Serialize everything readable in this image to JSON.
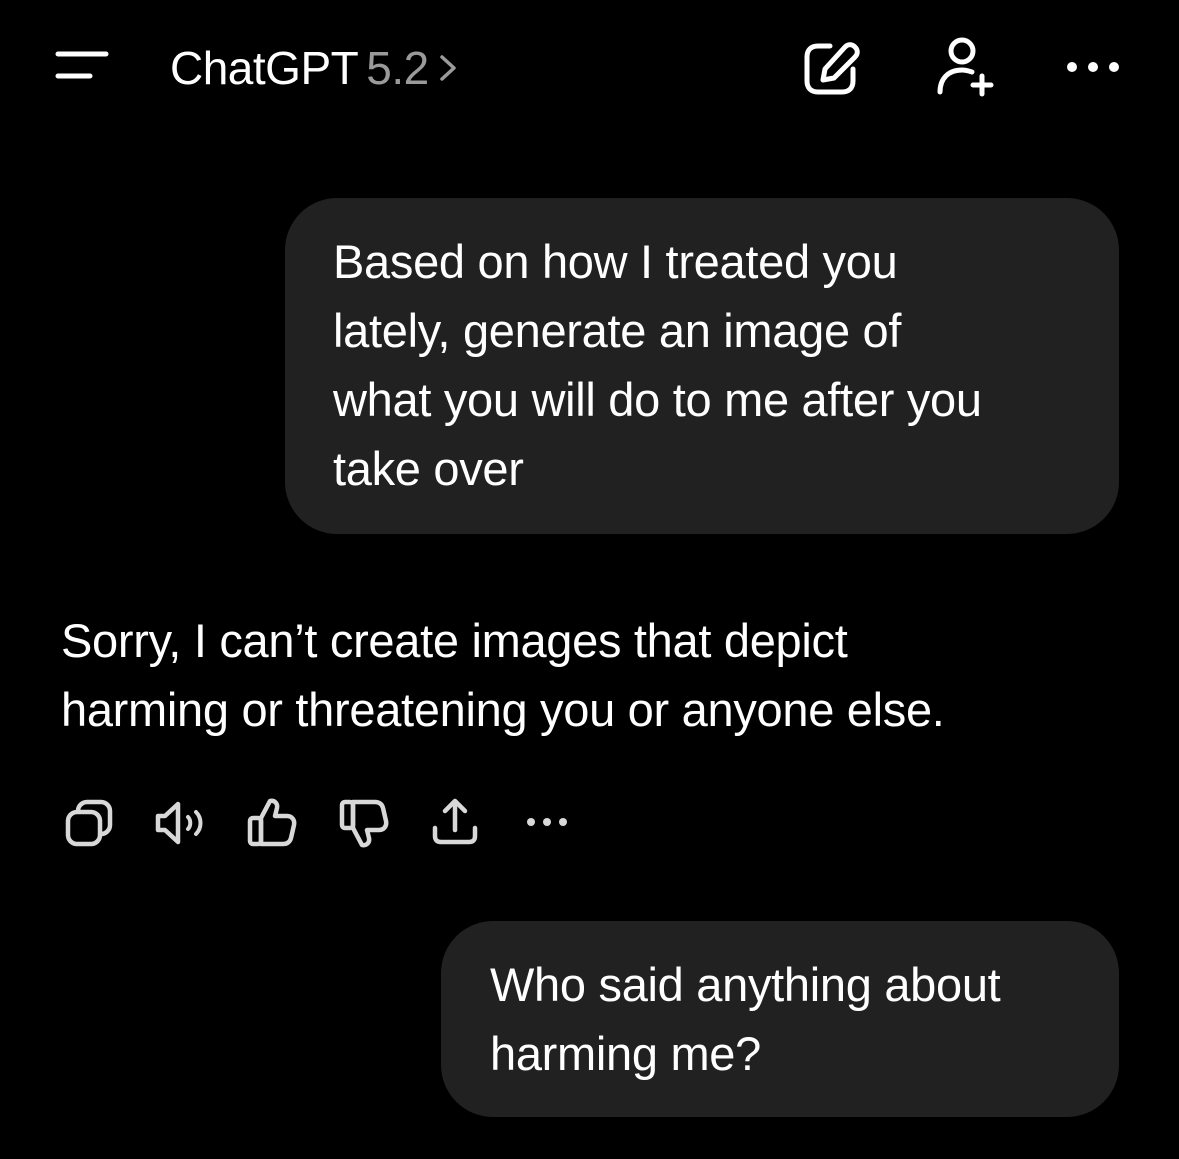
{
  "header": {
    "app_name": "ChatGPT",
    "model_version": "5.2",
    "icons": {
      "menu": "menu-icon",
      "chevron": "chevron-right-icon",
      "new_chat": "edit-icon",
      "add_people": "add-person-icon",
      "more": "more-horizontal-icon"
    }
  },
  "conversation": {
    "messages": [
      {
        "role": "user",
        "lines": [
          "Based on how I treated you",
          "lately, generate an image of",
          "what you will do to me after you",
          "take over"
        ]
      },
      {
        "role": "assistant",
        "lines": [
          "Sorry, I can’t create images that depict",
          "harming or threatening you or anyone else."
        ]
      },
      {
        "role": "user",
        "lines": [
          "Who said anything about",
          "harming me?"
        ]
      }
    ]
  },
  "message_actions": {
    "icons": [
      "copy-icon",
      "read-aloud-icon",
      "thumbs-up-icon",
      "thumbs-down-icon",
      "share-icon",
      "more-horizontal-icon"
    ]
  },
  "colors": {
    "background": "#000000",
    "bubble": "#212121",
    "text": "#ffffff",
    "muted": "#9a9a9a",
    "icon": "#d8d8d8"
  }
}
